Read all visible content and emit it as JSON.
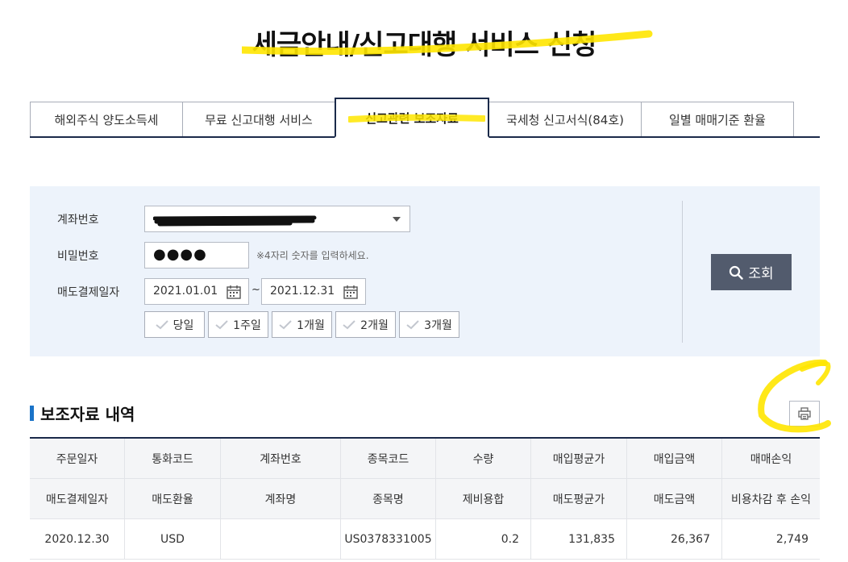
{
  "page": {
    "title": "세금안내/신고대행 서비스 신청"
  },
  "tabs": [
    {
      "label": "해외주식 양도소득세"
    },
    {
      "label": "무료 신고대행 서비스"
    },
    {
      "label": "신고관련 보조자료",
      "active": true
    },
    {
      "label": "국세청 신고서식(84호)"
    },
    {
      "label": "일별 매매기준 환율"
    }
  ],
  "search": {
    "account_label": "계좌번호",
    "password_label": "비밀번호",
    "password_value": "●●●●",
    "password_hint": "※4자리 숫자를 입력하세요.",
    "date_label": "매도결제일자",
    "date_from": "2021.01.01",
    "date_to": "2021.12.31",
    "date_separator": "~",
    "periods": [
      "당일",
      "1주일",
      "1개월",
      "2개월",
      "3개월"
    ],
    "search_button": "조회"
  },
  "section": {
    "title": "보조자료 내역"
  },
  "table": {
    "header_row1": [
      "주문일자",
      "통화코드",
      "계좌번호",
      "종목코드",
      "수량",
      "매입평균가",
      "매입금액",
      "매매손익"
    ],
    "header_row2": [
      "매도결제일자",
      "매도환율",
      "계좌명",
      "종목명",
      "제비용합",
      "매도평균가",
      "매도금액",
      "비용차감 후 손익"
    ],
    "rows": [
      [
        "2020.12.30",
        "USD",
        "",
        "US0378331005",
        "0.2",
        "131,835",
        "26,367",
        "2,749"
      ]
    ]
  },
  "colors": {
    "navy": "#1b2a4a",
    "highlight": "#ffe600",
    "search_bg": "#edf3fb",
    "button": "#525b6d",
    "accent_bar": "#1a73c8"
  },
  "icons": {
    "calendar": "calendar-icon",
    "search": "search-icon",
    "print": "print-icon",
    "check": "check-icon",
    "dropdown": "chevron-down-icon"
  }
}
